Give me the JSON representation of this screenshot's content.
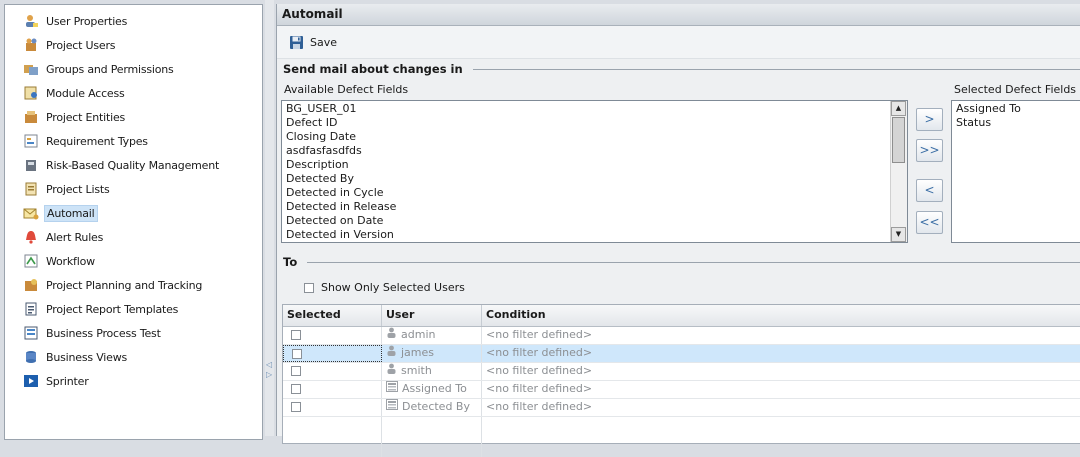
{
  "sidebar": {
    "items": [
      {
        "label": "User Properties",
        "icon": "user-properties-icon"
      },
      {
        "label": "Project Users",
        "icon": "project-users-icon"
      },
      {
        "label": "Groups and Permissions",
        "icon": "groups-icon"
      },
      {
        "label": "Module Access",
        "icon": "module-access-icon"
      },
      {
        "label": "Project Entities",
        "icon": "project-entities-icon"
      },
      {
        "label": "Requirement Types",
        "icon": "requirement-types-icon"
      },
      {
        "label": "Risk-Based Quality Management",
        "icon": "risk-quality-icon"
      },
      {
        "label": "Project Lists",
        "icon": "project-lists-icon"
      },
      {
        "label": "Automail",
        "icon": "automail-icon",
        "selected": true
      },
      {
        "label": "Alert Rules",
        "icon": "alert-rules-icon"
      },
      {
        "label": "Workflow",
        "icon": "workflow-icon"
      },
      {
        "label": "Project Planning and Tracking",
        "icon": "planning-icon"
      },
      {
        "label": "Project Report Templates",
        "icon": "report-templates-icon"
      },
      {
        "label": "Business Process Test",
        "icon": "business-process-icon"
      },
      {
        "label": "Business Views",
        "icon": "business-views-icon"
      },
      {
        "label": "Sprinter",
        "icon": "sprinter-icon"
      }
    ],
    "selected_color": "#cde3f7"
  },
  "panel": {
    "title": "Automail",
    "save_label": "Save",
    "send_mail_heading": "Send mail about changes in",
    "available_caption": "Available Defect Fields",
    "selected_caption": "Selected Defect Fields",
    "available_fields": [
      "BG_USER_01",
      "Defect ID",
      "Closing Date",
      "asdfasfasdfds",
      "Description",
      "Detected By",
      "Detected in Cycle",
      "Detected in Release",
      "Detected on Date",
      "Detected in Version"
    ],
    "selected_fields": [
      "Assigned To",
      "Status"
    ],
    "move_buttons": [
      ">",
      ">>",
      "<",
      "<<"
    ],
    "to_heading": "To",
    "show_only_label": "Show Only Selected Users"
  },
  "grid": {
    "headers": [
      "Selected",
      "User",
      "Condition"
    ],
    "rows": [
      {
        "user": "admin",
        "condition": "<no filter defined>",
        "icon": "user-icon",
        "selected": false
      },
      {
        "user": "james",
        "condition": "<no filter defined>",
        "icon": "user-icon",
        "selected": true
      },
      {
        "user": "smith",
        "condition": "<no filter defined>",
        "icon": "user-icon",
        "selected": false
      },
      {
        "user": "Assigned To",
        "condition": "<no filter defined>",
        "icon": "field-icon",
        "selected": false
      },
      {
        "user": "Detected By",
        "condition": "<no filter defined>",
        "icon": "field-icon",
        "selected": false
      }
    ],
    "selected_row_color": "#cfe7fb"
  }
}
